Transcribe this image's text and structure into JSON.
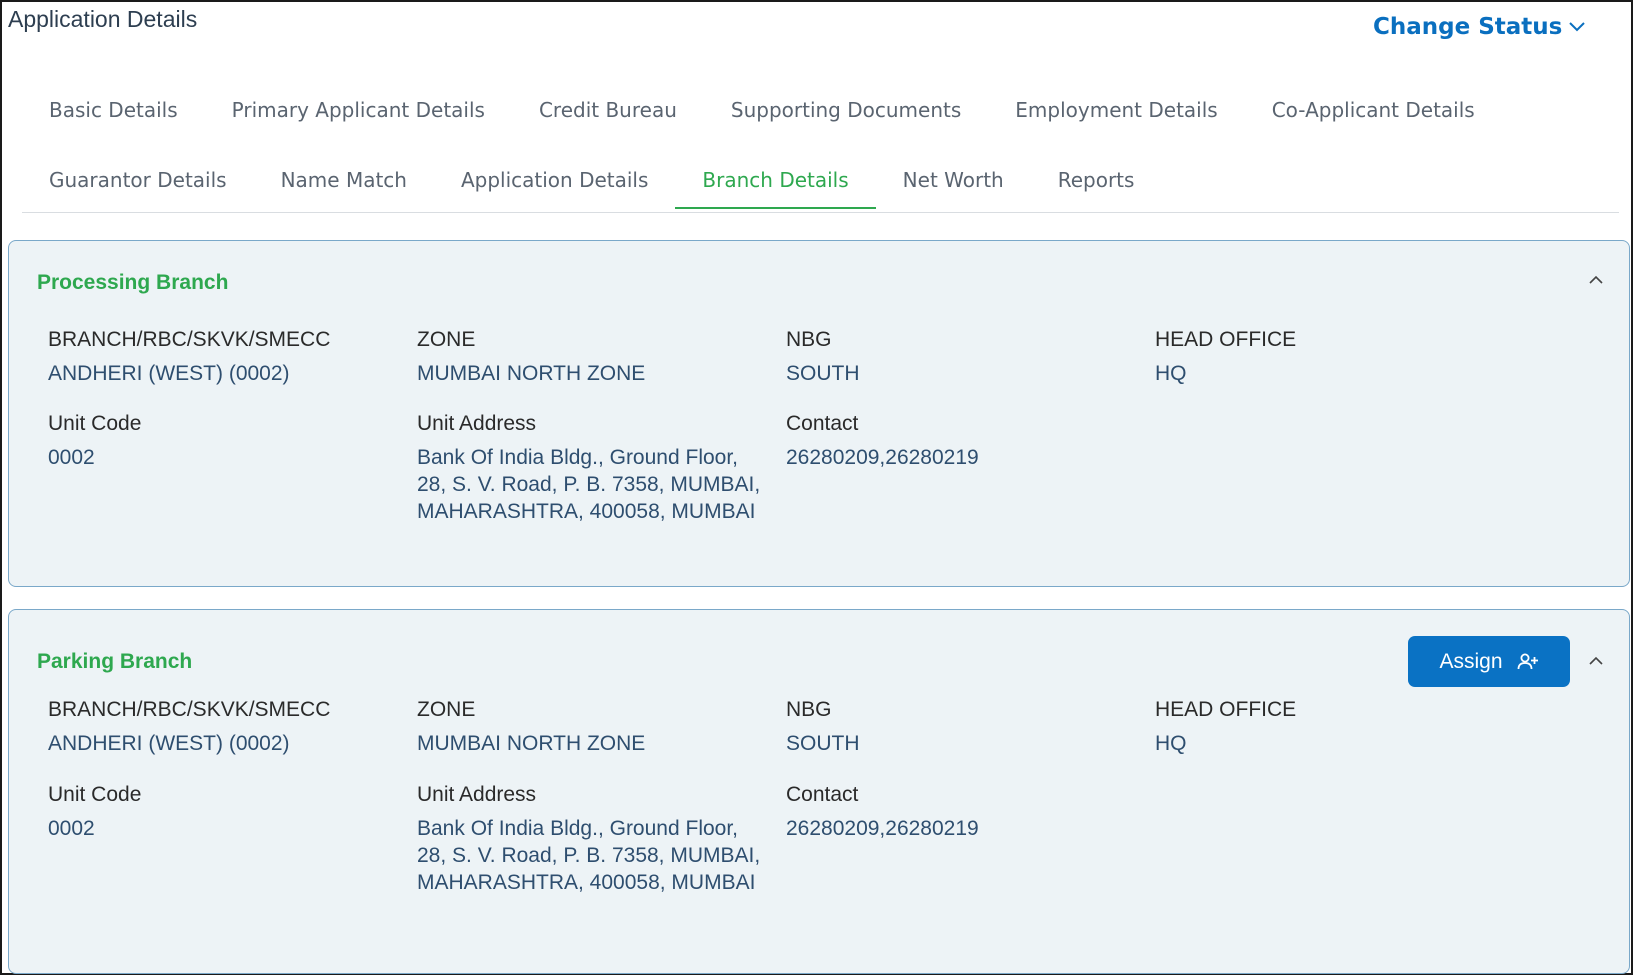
{
  "header": {
    "title": "Application Details",
    "change_status_label": "Change Status"
  },
  "tabs": {
    "row1": [
      "Basic Details",
      "Primary Applicant Details",
      "Credit Bureau",
      "Supporting Documents",
      "Employment Details",
      "Co-Applicant Details"
    ],
    "row2": [
      "Guarantor Details",
      "Name Match",
      "Application Details",
      "Branch Details",
      "Net Worth",
      "Reports"
    ],
    "active": "Branch Details"
  },
  "processing_branch": {
    "title": "Processing Branch",
    "branch_label": "BRANCH/RBC/SKVK/SMECC",
    "branch_value": "ANDHERI (WEST) (0002)",
    "zone_label": "ZONE",
    "zone_value": "MUMBAI NORTH ZONE",
    "nbg_label": "NBG",
    "nbg_value": "SOUTH",
    "head_office_label": "HEAD OFFICE",
    "head_office_value": "HQ",
    "unit_code_label": "Unit Code",
    "unit_code_value": "0002",
    "unit_address_label": "Unit Address",
    "unit_address_lines": [
      "Bank Of India Bldg., Ground Floor,",
      "28, S. V. Road, P. B. 7358, MUMBAI,",
      "MAHARASHTRA, 400058, MUMBAI"
    ],
    "contact_label": "Contact",
    "contact_value": "26280209,26280219"
  },
  "parking_branch": {
    "title": "Parking Branch",
    "assign_label": "Assign",
    "branch_label": "BRANCH/RBC/SKVK/SMECC",
    "branch_value": "ANDHERI (WEST) (0002)",
    "zone_label": "ZONE",
    "zone_value": "MUMBAI NORTH ZONE",
    "nbg_label": "NBG",
    "nbg_value": "SOUTH",
    "head_office_label": "HEAD OFFICE",
    "head_office_value": "HQ",
    "unit_code_label": "Unit Code",
    "unit_code_value": "0002",
    "unit_address_label": "Unit Address",
    "unit_address_lines": [
      "Bank Of India Bldg., Ground Floor,",
      "28, S. V. Road, P. B. 7358, MUMBAI,",
      "MAHARASHTRA, 400058, MUMBAI"
    ],
    "contact_label": "Contact",
    "contact_value": "26280209,26280219"
  },
  "colors": {
    "accent_green": "#2ea84f",
    "primary_blue": "#0a72c4",
    "card_bg": "#edf3f6",
    "card_border": "#7aa8c9"
  },
  "icons": {
    "change_status": "chevron-down-icon",
    "collapse": "chevron-up-icon",
    "assign": "add-user-icon"
  }
}
